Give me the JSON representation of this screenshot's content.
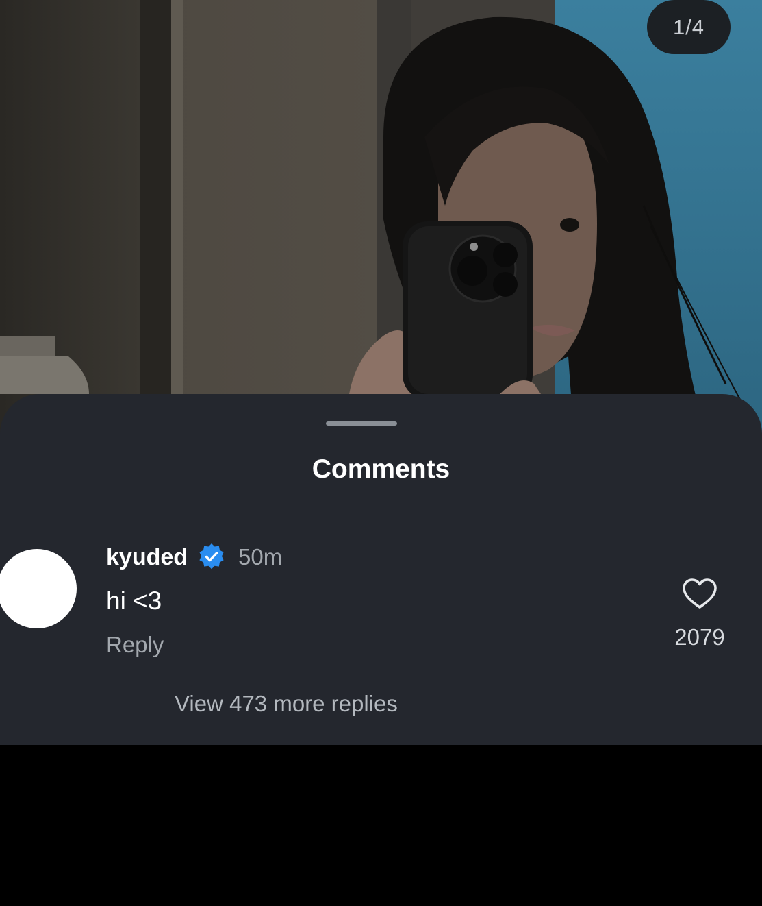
{
  "post": {
    "image_counter": "1/4"
  },
  "comments_sheet": {
    "title": "Comments",
    "comment": {
      "username": "kyuded",
      "verified": true,
      "time": "50m",
      "text": "hi <3",
      "reply_label": "Reply",
      "like_count": "2079",
      "view_more_replies": "View 473 more replies"
    }
  },
  "icons": {
    "verified": "verified-badge-icon",
    "like": "heart-outline-icon"
  },
  "colors": {
    "sheet_background": "#24272e",
    "verified_blue": "#2a8df0",
    "secondary_text": "#a3a8ae"
  }
}
